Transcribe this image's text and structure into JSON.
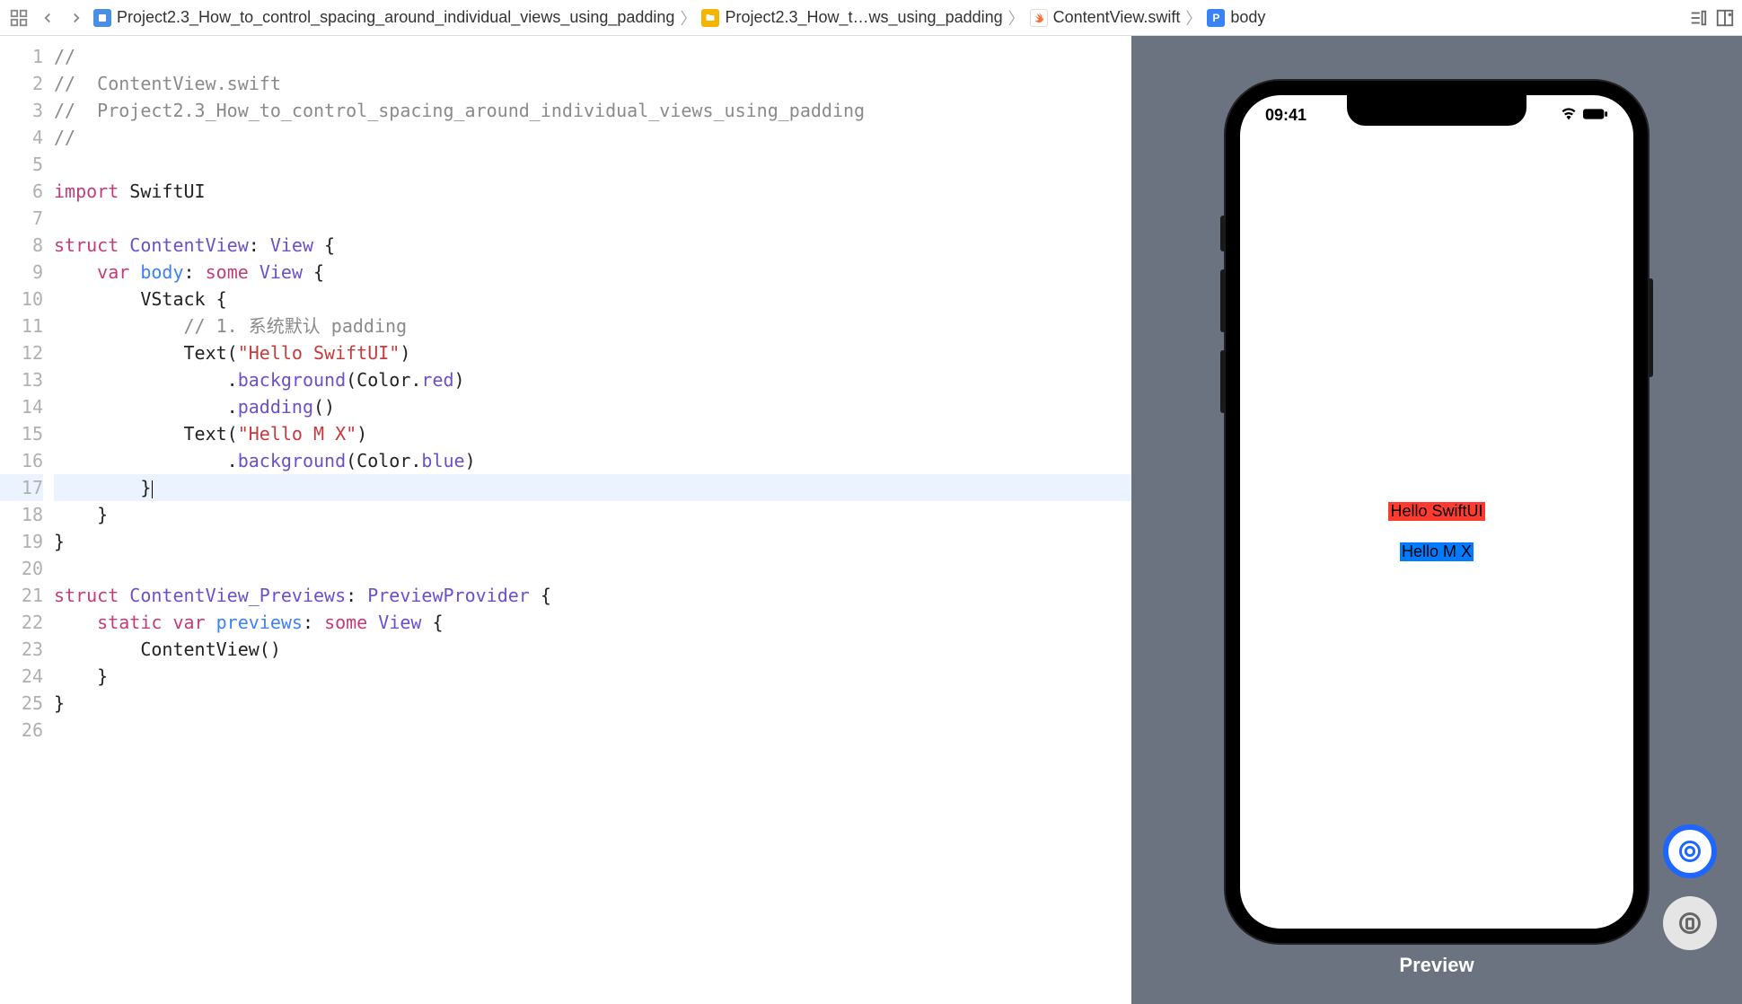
{
  "breadcrumb": {
    "project": "Project2.3_How_to_control_spacing_around_individual_views_using_padding",
    "folder": "Project2.3_How_t…ws_using_padding",
    "file": "ContentView.swift",
    "symbol": "body"
  },
  "code": {
    "lines": [
      {
        "n": 1,
        "segs": [
          {
            "t": "//",
            "c": "tok-comment"
          }
        ]
      },
      {
        "n": 2,
        "segs": [
          {
            "t": "//  ContentView.swift",
            "c": "tok-comment"
          }
        ]
      },
      {
        "n": 3,
        "segs": [
          {
            "t": "//  Project2.3_How_to_control_spacing_around_individual_views_using_padding",
            "c": "tok-comment"
          }
        ]
      },
      {
        "n": 4,
        "segs": [
          {
            "t": "//",
            "c": "tok-comment"
          }
        ]
      },
      {
        "n": 5,
        "segs": []
      },
      {
        "n": 6,
        "segs": [
          {
            "t": "import",
            "c": "tok-keyword"
          },
          {
            "t": " SwiftUI",
            "c": "tok-plain"
          }
        ]
      },
      {
        "n": 7,
        "segs": []
      },
      {
        "n": 8,
        "segs": [
          {
            "t": "struct",
            "c": "tok-keyword"
          },
          {
            "t": " ",
            "c": "tok-plain"
          },
          {
            "t": "ContentView",
            "c": "tok-type"
          },
          {
            "t": ": ",
            "c": "tok-plain"
          },
          {
            "t": "View",
            "c": "tok-type"
          },
          {
            "t": " {",
            "c": "tok-plain"
          }
        ]
      },
      {
        "n": 9,
        "segs": [
          {
            "t": "    ",
            "c": "tok-plain"
          },
          {
            "t": "var",
            "c": "tok-keyword"
          },
          {
            "t": " ",
            "c": "tok-plain"
          },
          {
            "t": "body",
            "c": "tok-funcname"
          },
          {
            "t": ": ",
            "c": "tok-plain"
          },
          {
            "t": "some",
            "c": "tok-keyword"
          },
          {
            "t": " ",
            "c": "tok-plain"
          },
          {
            "t": "View",
            "c": "tok-type"
          },
          {
            "t": " {",
            "c": "tok-plain"
          }
        ]
      },
      {
        "n": 10,
        "segs": [
          {
            "t": "        VStack {",
            "c": "tok-plain"
          }
        ]
      },
      {
        "n": 11,
        "segs": [
          {
            "t": "            ",
            "c": "tok-plain"
          },
          {
            "t": "// 1. 系统默认 padding",
            "c": "tok-comment"
          }
        ]
      },
      {
        "n": 12,
        "segs": [
          {
            "t": "            Text(",
            "c": "tok-plain"
          },
          {
            "t": "\"Hello SwiftUI\"",
            "c": "tok-string"
          },
          {
            "t": ")",
            "c": "tok-plain"
          }
        ]
      },
      {
        "n": 13,
        "segs": [
          {
            "t": "                .",
            "c": "tok-plain"
          },
          {
            "t": "background",
            "c": "tok-member"
          },
          {
            "t": "(Color.",
            "c": "tok-plain"
          },
          {
            "t": "red",
            "c": "tok-member"
          },
          {
            "t": ")",
            "c": "tok-plain"
          }
        ]
      },
      {
        "n": 14,
        "segs": [
          {
            "t": "                .",
            "c": "tok-plain"
          },
          {
            "t": "padding",
            "c": "tok-member"
          },
          {
            "t": "()",
            "c": "tok-plain"
          }
        ]
      },
      {
        "n": 15,
        "segs": [
          {
            "t": "            Text(",
            "c": "tok-plain"
          },
          {
            "t": "\"Hello M X\"",
            "c": "tok-string"
          },
          {
            "t": ")",
            "c": "tok-plain"
          }
        ]
      },
      {
        "n": 16,
        "segs": [
          {
            "t": "                .",
            "c": "tok-plain"
          },
          {
            "t": "background",
            "c": "tok-member"
          },
          {
            "t": "(Color.",
            "c": "tok-plain"
          },
          {
            "t": "blue",
            "c": "tok-member"
          },
          {
            "t": ")",
            "c": "tok-plain"
          }
        ]
      },
      {
        "n": 17,
        "hl": true,
        "segs": [
          {
            "t": "        }",
            "c": "tok-plain"
          }
        ],
        "cursor": true
      },
      {
        "n": 18,
        "segs": [
          {
            "t": "    }",
            "c": "tok-plain"
          }
        ]
      },
      {
        "n": 19,
        "segs": [
          {
            "t": "}",
            "c": "tok-plain"
          }
        ]
      },
      {
        "n": 20,
        "segs": []
      },
      {
        "n": 21,
        "segs": [
          {
            "t": "struct",
            "c": "tok-keyword"
          },
          {
            "t": " ",
            "c": "tok-plain"
          },
          {
            "t": "ContentView_Previews",
            "c": "tok-type"
          },
          {
            "t": ": ",
            "c": "tok-plain"
          },
          {
            "t": "PreviewProvider",
            "c": "tok-type"
          },
          {
            "t": " {",
            "c": "tok-plain"
          }
        ]
      },
      {
        "n": 22,
        "segs": [
          {
            "t": "    ",
            "c": "tok-plain"
          },
          {
            "t": "static",
            "c": "tok-keyword"
          },
          {
            "t": " ",
            "c": "tok-plain"
          },
          {
            "t": "var",
            "c": "tok-keyword"
          },
          {
            "t": " ",
            "c": "tok-plain"
          },
          {
            "t": "previews",
            "c": "tok-funcname"
          },
          {
            "t": ": ",
            "c": "tok-plain"
          },
          {
            "t": "some",
            "c": "tok-keyword"
          },
          {
            "t": " ",
            "c": "tok-plain"
          },
          {
            "t": "View",
            "c": "tok-type"
          },
          {
            "t": " {",
            "c": "tok-plain"
          }
        ]
      },
      {
        "n": 23,
        "segs": [
          {
            "t": "        ContentView()",
            "c": "tok-plain"
          }
        ]
      },
      {
        "n": 24,
        "segs": [
          {
            "t": "    }",
            "c": "tok-plain"
          }
        ]
      },
      {
        "n": 25,
        "segs": [
          {
            "t": "}",
            "c": "tok-plain"
          }
        ]
      },
      {
        "n": 26,
        "segs": []
      }
    ]
  },
  "preview": {
    "time": "09:41",
    "text1": "Hello SwiftUI",
    "text2": "Hello M X",
    "label": "Preview"
  }
}
